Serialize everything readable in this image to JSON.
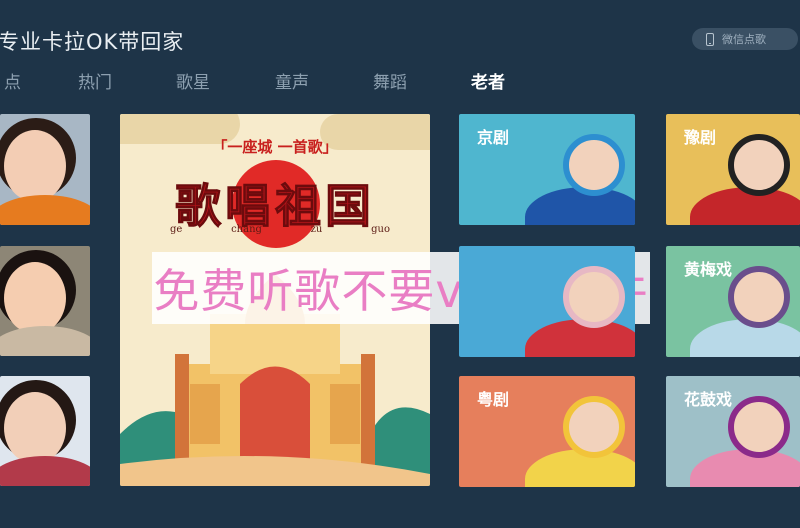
{
  "app": {
    "title": "专业卡拉OK带回家",
    "wechat_button": "微信点歌"
  },
  "tabs": [
    {
      "label": "点",
      "active": false
    },
    {
      "label": "热门",
      "active": false
    },
    {
      "label": "歌星",
      "active": false
    },
    {
      "label": "童声",
      "active": false
    },
    {
      "label": "舞蹈",
      "active": false
    },
    {
      "label": "老者",
      "active": true
    }
  ],
  "poster": {
    "subtitle": "「一座城 一首歌」",
    "title": "歌唱祖国",
    "pinyin": [
      "ge",
      "chang",
      "zu",
      "guo"
    ]
  },
  "overlay_text": "免费听歌不要vip的软件",
  "categories": [
    {
      "label": "京剧",
      "color": "#4fb6cf"
    },
    {
      "label": "豫剧",
      "color": "#e8bf5a"
    },
    {
      "label": "",
      "color": "#4aa9d6"
    },
    {
      "label": "黄梅戏",
      "color": "#7ac3a1"
    },
    {
      "label": "粤剧",
      "color": "#e67f5c"
    },
    {
      "label": "花鼓戏",
      "color": "#9ec0c8"
    }
  ],
  "colors": {
    "background": "#1e3448",
    "tab_active": "#ffffff",
    "tab_inactive": "#8da0b0",
    "overlay_text": "#e97ec4"
  }
}
